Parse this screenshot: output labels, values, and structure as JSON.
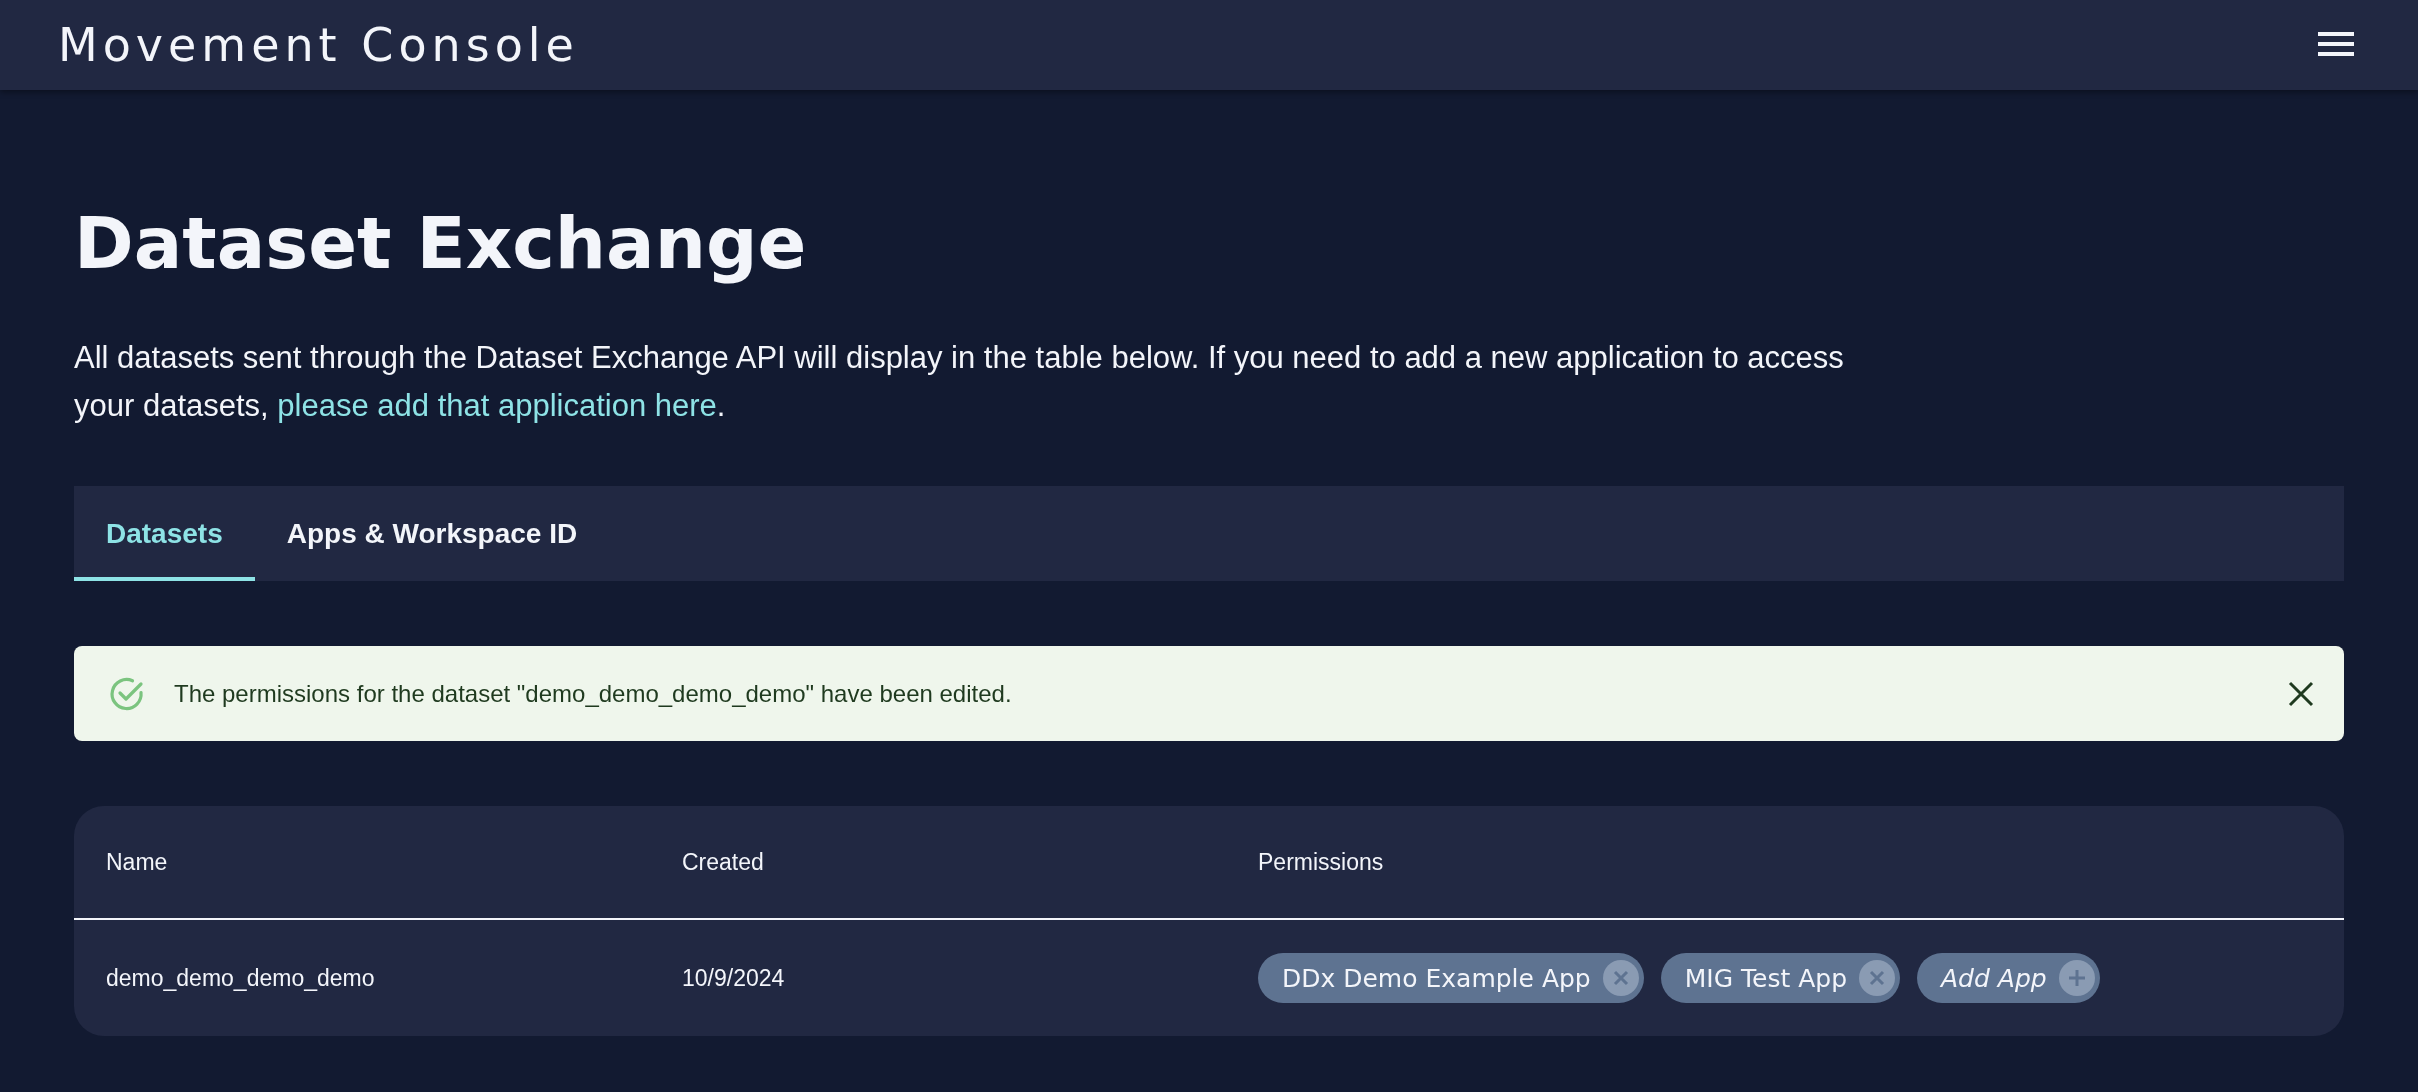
{
  "header": {
    "title": "Movement Console"
  },
  "page": {
    "title": "Dataset Exchange",
    "intro": "All datasets sent through the Dataset Exchange API will display in the table below. If you need to add a new application to access your datasets, ",
    "intro_link": "please add that application here",
    "intro_end": "."
  },
  "tabs": [
    {
      "label": "Datasets",
      "selected": true
    },
    {
      "label": "Apps & Workspace ID",
      "selected": false
    }
  ],
  "alert": {
    "message": "The permissions for the dataset \"demo_demo_demo_demo\" have been edited."
  },
  "table": {
    "columns": [
      "Name",
      "Created",
      "Permissions"
    ],
    "rows": [
      {
        "name": "demo_demo_demo_demo",
        "created": "10/9/2024",
        "permissions": [
          {
            "kind": "app",
            "label": "DDx Demo Example App"
          },
          {
            "kind": "app",
            "label": "MIG Test App"
          },
          {
            "kind": "add",
            "label": "Add App"
          }
        ]
      }
    ]
  }
}
